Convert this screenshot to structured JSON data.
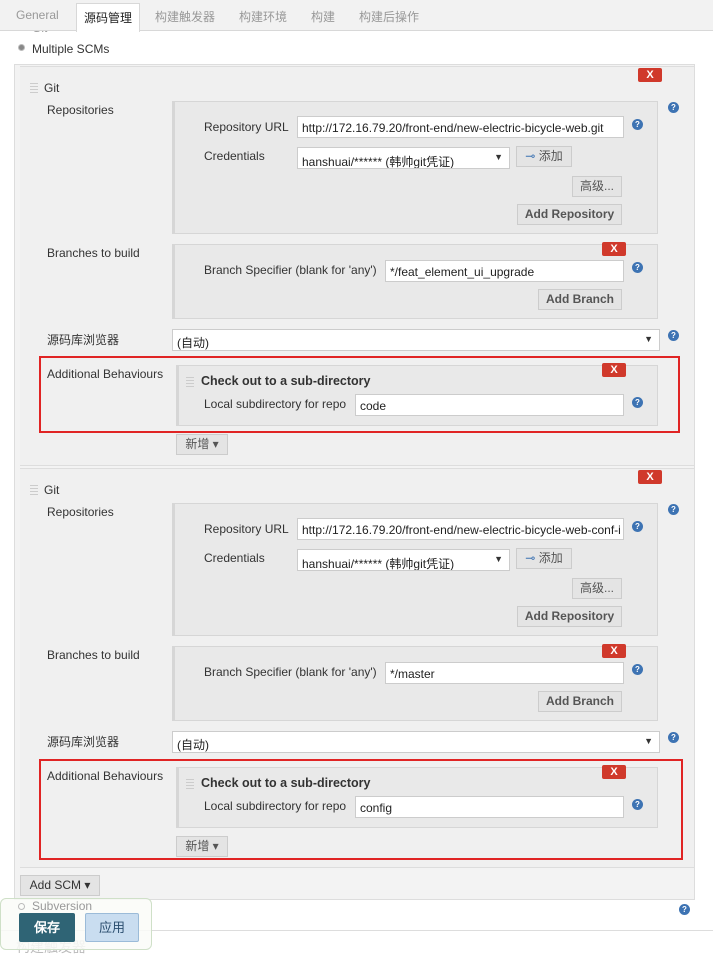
{
  "tabs": [
    {
      "label": "General"
    },
    {
      "label": "源码管理"
    },
    {
      "label": "构建触发器"
    },
    {
      "label": "构建环境"
    },
    {
      "label": "构建"
    },
    {
      "label": "构建后操作"
    }
  ],
  "scm_options": {
    "git": "Git",
    "multiple": "Multiple SCMs",
    "subversion": "Subversion",
    "selected": "Multiple SCMs"
  },
  "labels": {
    "delete": "X",
    "git": "Git",
    "repositories": "Repositories",
    "repo_url": "Repository URL",
    "credentials": "Credentials",
    "add": "添加",
    "advanced": "高级...",
    "add_repository": "Add Repository",
    "branches": "Branches to build",
    "branch_spec": "Branch Specifier (blank for 'any')",
    "add_branch": "Add Branch",
    "browser": "源码库浏览器",
    "additional": "Additional Behaviours",
    "checkout_sub": "Check out to a sub-directory",
    "local_sub": "Local subdirectory for repo",
    "new": "新增",
    "help": "?"
  },
  "scms": [
    {
      "repo_url": "http://172.16.79.20/front-end/new-electric-bicycle-web.git",
      "credentials": "hanshuai/****** (韩帅git凭证)",
      "branch": "*/feat_element_ui_upgrade",
      "browser": "(自动)",
      "subdir": "code"
    },
    {
      "repo_url": "http://172.16.79.20/front-end/new-electric-bicycle-web-conf-i",
      "credentials": "hanshuai/****** (韩帅git凭证)",
      "branch": "*/master",
      "browser": "(自动)",
      "subdir": "config"
    }
  ],
  "add_scm": "Add SCM",
  "footer": {
    "save": "保存",
    "apply": "应用",
    "behind_text": "构建触发器"
  },
  "colors": {
    "highlight": "#e02424",
    "delete": "#d0392b",
    "save": "#2f6475",
    "apply": "#c9ddf0"
  }
}
